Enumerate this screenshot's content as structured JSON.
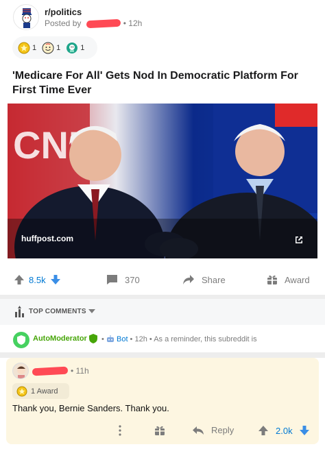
{
  "post": {
    "subreddit": "r/politics",
    "posted_by_label": "Posted by",
    "age": "12h",
    "awards": [
      {
        "icon": "gold-award-icon",
        "count": "1"
      },
      {
        "icon": "wholesome-award-icon",
        "count": "1"
      },
      {
        "icon": "helpful-award-icon",
        "count": "1"
      }
    ],
    "title": "'Medicare For All' Gets Nod In Democratic Platform For First Time Ever",
    "link_domain": "huffpost.com",
    "votes": "8.5k",
    "comments": "370",
    "share_label": "Share",
    "award_label": "Award"
  },
  "comments_header": {
    "label": "TOP COMMENTS"
  },
  "automod": {
    "name": "AutoModerator",
    "bot_label": "Bot",
    "age": "12h",
    "preview": "As a reminder, this subreddit is"
  },
  "comment": {
    "age": "11h",
    "award_label": "1 Award",
    "body": "Thank you, Bernie Sanders. Thank you.",
    "reply_label": "Reply",
    "votes": "2.0k"
  },
  "colors": {
    "upvote": "#0079d3",
    "automod_green": "#46a508",
    "redaction": "#ff4a55",
    "highlight_bg": "#fdf6e1"
  }
}
